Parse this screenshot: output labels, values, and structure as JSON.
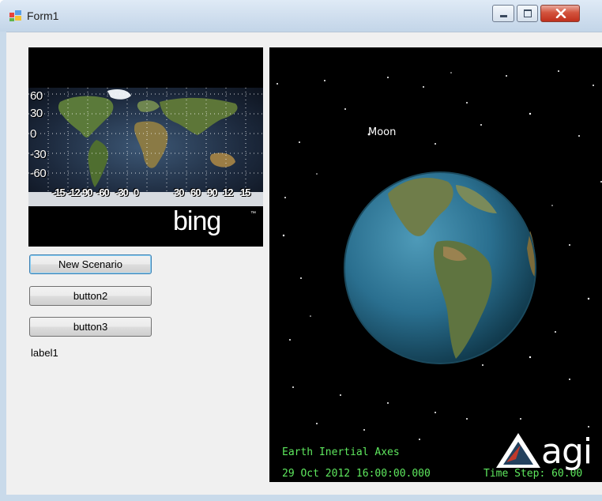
{
  "window": {
    "title": "Form1",
    "icons": {
      "app": "windows-form-icon",
      "minimize": "minimize-icon",
      "maximize": "maximize-icon",
      "close": "close-icon"
    }
  },
  "map": {
    "lat_labels": [
      "60",
      "30",
      "0",
      "-30",
      "-60"
    ],
    "lon_labels": [
      "-15",
      "-12",
      "90",
      "-60",
      "-30",
      "0",
      "30",
      "60",
      "90",
      "12",
      "15"
    ],
    "logo": "bing",
    "logo_tm": "™"
  },
  "buttons": {
    "new_scenario": "New Scenario",
    "button2": "button2",
    "button3": "button3"
  },
  "label1": "label1",
  "globe": {
    "moon_label": "Moon",
    "axes_label": "Earth Inertial Axes",
    "time_label": "29 Oct 2012 16:00:00.000",
    "step_label": "Time Step: 60.00",
    "logo": "agi"
  },
  "colors": {
    "overlay_text": "#5ee85e",
    "window_frame": "#c9daea",
    "client_bg": "#f0f0f0"
  }
}
